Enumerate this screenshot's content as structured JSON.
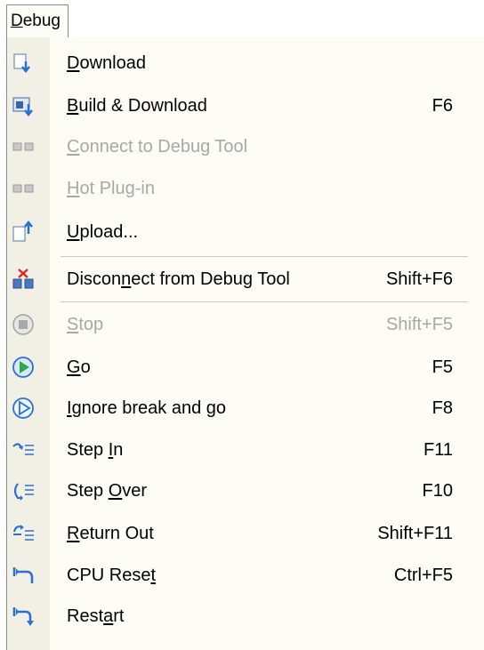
{
  "menubar": {
    "title": "Debug"
  },
  "menu": {
    "items": [
      {
        "label": "Download",
        "shortcut": "",
        "mnemonic_index": 0,
        "icon": "download-icon",
        "disabled": false
      },
      {
        "label": "Build & Download",
        "shortcut": "F6",
        "mnemonic_index": 0,
        "icon": "build-download-icon",
        "disabled": false
      },
      {
        "label": "Connect to Debug Tool",
        "shortcut": "",
        "mnemonic_index": 0,
        "icon": "connect-icon",
        "disabled": true
      },
      {
        "label": "Hot Plug-in",
        "shortcut": "",
        "mnemonic_index": 0,
        "icon": "hot-plug-in-icon",
        "disabled": true
      },
      {
        "label": "Upload...",
        "shortcut": "",
        "mnemonic_index": 0,
        "icon": "upload-icon",
        "disabled": false
      },
      {
        "label": "Disconnect from Debug Tool",
        "shortcut": "Shift+F6",
        "mnemonic_index": 6,
        "icon": "disconnect-icon",
        "disabled": false
      },
      {
        "label": "Stop",
        "shortcut": "Shift+F5",
        "mnemonic_index": 0,
        "icon": "stop-icon",
        "disabled": true
      },
      {
        "label": "Go",
        "shortcut": "F5",
        "mnemonic_index": 0,
        "icon": "go-icon",
        "disabled": false
      },
      {
        "label": "Ignore break and go",
        "shortcut": "F8",
        "mnemonic_index": 0,
        "icon": "ignore-break-go-icon",
        "disabled": false
      },
      {
        "label": "Step In",
        "shortcut": "F11",
        "mnemonic_index": 5,
        "icon": "step-in-icon",
        "disabled": false
      },
      {
        "label": "Step Over",
        "shortcut": "F10",
        "mnemonic_index": 5,
        "icon": "step-over-icon",
        "disabled": false
      },
      {
        "label": "Return Out",
        "shortcut": "Shift+F11",
        "mnemonic_index": 0,
        "icon": "return-out-icon",
        "disabled": false
      },
      {
        "label": "CPU Reset",
        "shortcut": "Ctrl+F5",
        "mnemonic_index": 8,
        "icon": "cpu-reset-icon",
        "disabled": false
      },
      {
        "label": "Restart",
        "shortcut": "",
        "mnemonic_index": 4,
        "icon": "restart-icon",
        "disabled": false
      }
    ]
  },
  "colors": {
    "menu_background": "#fdfdf6",
    "icon_gutter": "#f2f0e4",
    "disabled_text": "#a8a8a8",
    "icon_blue": "#2a6fd6",
    "icon_green": "#2aa84a"
  }
}
